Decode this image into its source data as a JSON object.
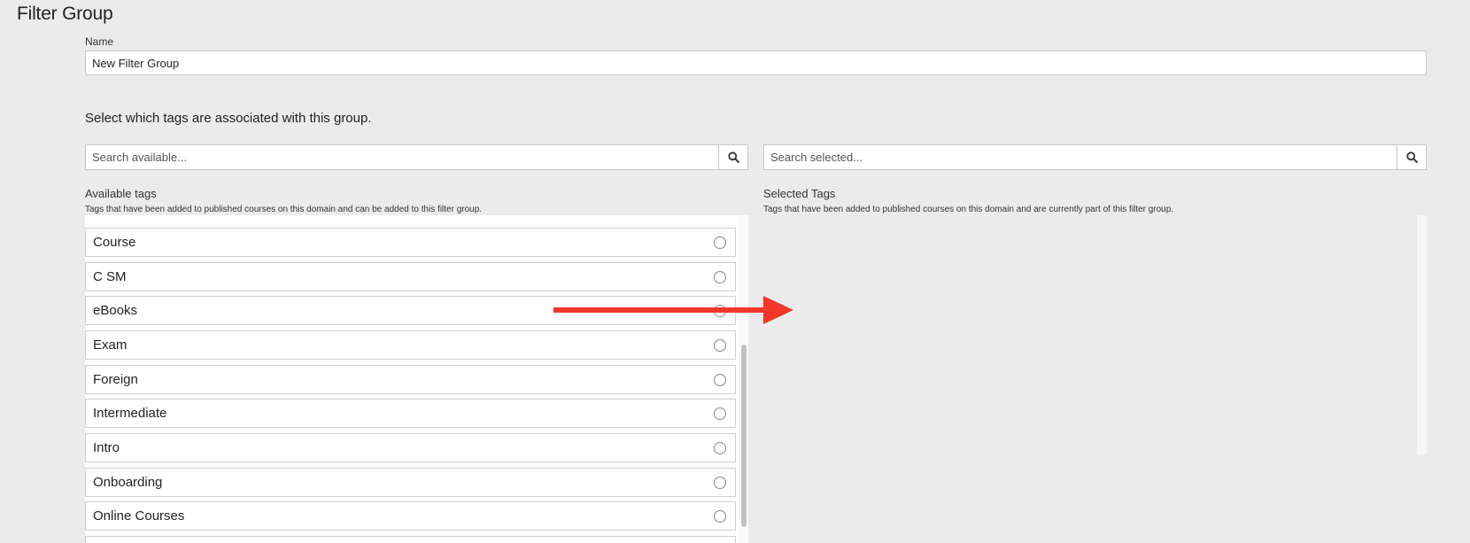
{
  "page": {
    "title": "Filter Group"
  },
  "name_field": {
    "label": "Name",
    "value": "New Filter Group"
  },
  "instructions": "Select which tags are associated with this group.",
  "available": {
    "search_placeholder": "Search available...",
    "title": "Available tags",
    "description": "Tags that have been added to published courses on this domain and can be added to this filter group.",
    "tags": [
      {
        "label": "Course",
        "selected": false
      },
      {
        "label": "C SM",
        "selected": false
      },
      {
        "label": "eBooks",
        "selected": false
      },
      {
        "label": "Exam",
        "selected": false
      },
      {
        "label": "Foreign",
        "selected": false
      },
      {
        "label": "Intermediate",
        "selected": false
      },
      {
        "label": "Intro",
        "selected": false
      },
      {
        "label": "Onboarding",
        "selected": false
      },
      {
        "label": "Online Courses",
        "selected": false
      }
    ]
  },
  "selected": {
    "search_placeholder": "Search selected...",
    "title": "Selected Tags",
    "description": "Tags that have been added to published courses on this domain and are currently part of this filter group.",
    "tags": []
  },
  "icons": {
    "search": "search-icon",
    "radio": "radio-empty-icon",
    "arrow": "arrow-right-icon"
  },
  "colors": {
    "background": "#ebebeb",
    "annotation_arrow": "#f2362b"
  }
}
